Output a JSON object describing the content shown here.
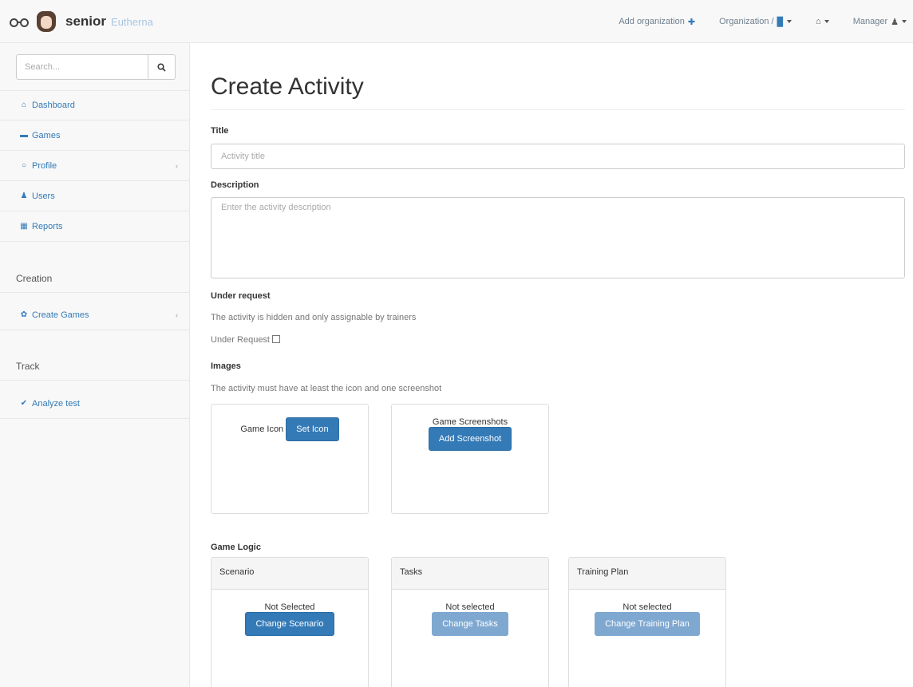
{
  "brand": {
    "name": "senior",
    "sub": "Eutherna"
  },
  "navbar": {
    "add_org": "Add organization",
    "organization": "Organization /",
    "user": "Manager"
  },
  "sidebar": {
    "search_placeholder": "Search...",
    "items": [
      {
        "label": "Dashboard",
        "icon": "home-icon"
      },
      {
        "label": "Games",
        "icon": "gamepad-icon"
      },
      {
        "label": "Profile",
        "icon": "circle-icon"
      },
      {
        "label": "Users",
        "icon": "user-icon"
      },
      {
        "label": "Reports",
        "icon": "chart-icon"
      }
    ],
    "creation_heading": "Creation",
    "creation_items": [
      {
        "label": "Create Games",
        "icon": "gear-icon"
      }
    ],
    "track_heading": "Track",
    "track_items": [
      {
        "label": "Analyze test",
        "icon": "check-icon"
      }
    ]
  },
  "main": {
    "title": "Create Activity",
    "title_label": "Title",
    "title_placeholder": "Activity title",
    "description_label": "Description",
    "description_placeholder": "Enter the activity description",
    "under_request_label": "Under request",
    "under_request_help": "The activity is hidden and only assignable by trainers",
    "under_request_checkbox": "Under Request",
    "images_label": "Images",
    "images_help": "The activity must have at least the icon and one screenshot",
    "game_icon_label": "Game Icon",
    "set_icon_button": "Set Icon",
    "screenshots_label": "Game Screenshots",
    "add_screenshot_button": "Add Screenshot",
    "game_logic_label": "Game Logic",
    "logic_panels": [
      {
        "title": "Scenario",
        "status": "Not Selected",
        "button": "Change Scenario"
      },
      {
        "title": "Tasks",
        "status": "Not selected",
        "button": "Change Tasks"
      },
      {
        "title": "Training Plan",
        "status": "Not selected",
        "button": "Change Training Plan"
      }
    ]
  }
}
